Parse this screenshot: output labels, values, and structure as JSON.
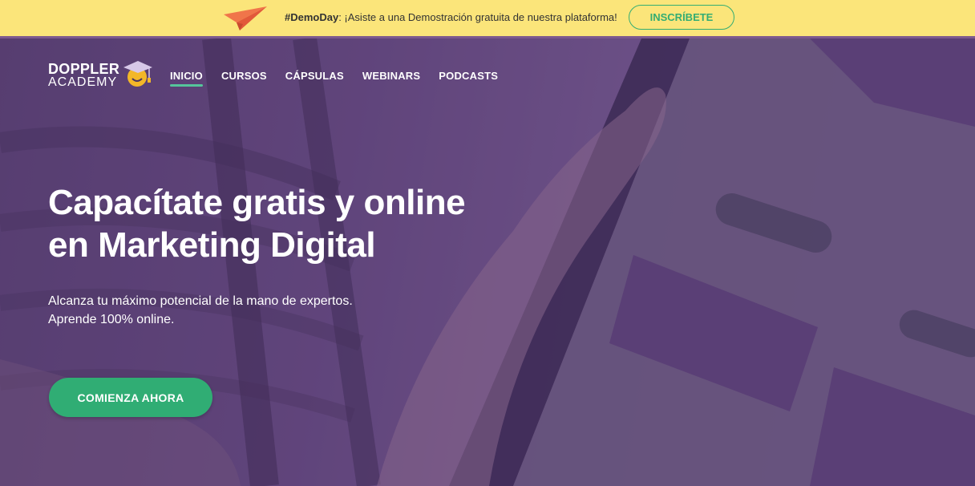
{
  "promo": {
    "hashtag": "#DemoDay",
    "message": ": ¡Asiste a una Demostración gratuita de nuestra plataforma!",
    "button_label": "INSCRÍBETE",
    "icon": "paper-plane-icon"
  },
  "logo": {
    "line1": "DOPPLER",
    "line2": "ACADEMY",
    "icon": "graduation-cap-icon"
  },
  "nav": {
    "items": [
      {
        "label": "INICIO",
        "active": true
      },
      {
        "label": "CURSOS",
        "active": false
      },
      {
        "label": "CÁPSULAS",
        "active": false
      },
      {
        "label": "WEBINARS",
        "active": false
      },
      {
        "label": "PODCASTS",
        "active": false
      }
    ]
  },
  "hero": {
    "headline_line1": "Capacítate gratis y online",
    "headline_line2": "en Marketing Digital",
    "subtext_line1": "Alcanza tu máximo potencial de la mano de expertos.",
    "subtext_line2": "Aprende 100% online.",
    "cta_label": "COMIENZA AHORA"
  },
  "colors": {
    "promo_bg": "#fbe57a",
    "accent_green": "#30ad74",
    "hero_overlay": "#5c4376",
    "nav_underline": "#55c59b"
  }
}
